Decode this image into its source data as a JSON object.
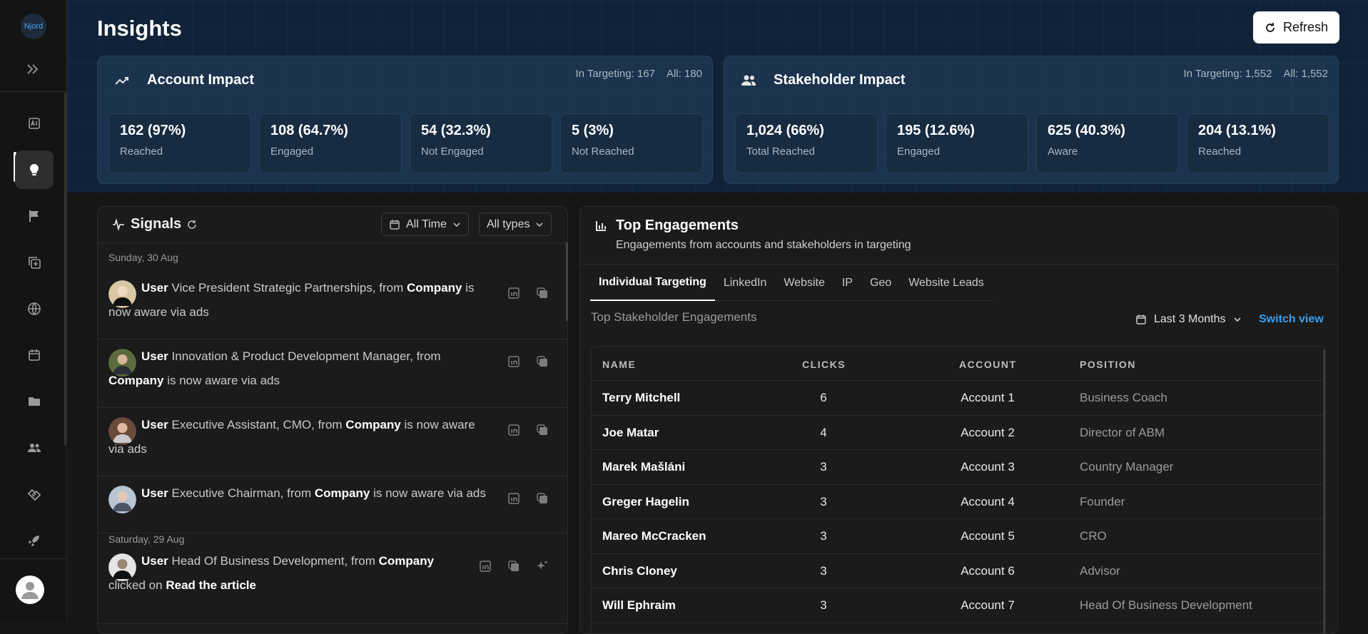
{
  "sidebar": {
    "logo_text": "Njord",
    "nav": [
      {
        "icon": "ai-report-icon",
        "active": false
      },
      {
        "icon": "lightbulb-icon",
        "active": true
      },
      {
        "icon": "flag-icon",
        "active": false
      },
      {
        "icon": "add-copy-icon",
        "active": false
      },
      {
        "icon": "globe-icon",
        "active": false
      },
      {
        "icon": "calendar-icon",
        "active": false
      },
      {
        "icon": "folder-icon",
        "active": false
      },
      {
        "icon": "people-icon",
        "active": false
      },
      {
        "icon": "handshake-icon",
        "active": false
      },
      {
        "icon": "rocket-icon",
        "active": false
      }
    ]
  },
  "header": {
    "title": "Insights",
    "refresh_label": "Refresh"
  },
  "account_impact": {
    "title": "Account Impact",
    "in_targeting": "In Targeting: 167",
    "all": "All: 180",
    "metrics": [
      {
        "value": "162 (97%)",
        "label": "Reached"
      },
      {
        "value": "108 (64.7%)",
        "label": "Engaged"
      },
      {
        "value": "54 (32.3%)",
        "label": "Not Engaged"
      },
      {
        "value": "5 (3%)",
        "label": "Not Reached"
      }
    ]
  },
  "stakeholder_impact": {
    "title": "Stakeholder Impact",
    "in_targeting": "In Targeting: 1,552",
    "all": "All: 1,552",
    "metrics": [
      {
        "value": "1,024 (66%)",
        "label": "Total Reached"
      },
      {
        "value": "195 (12.6%)",
        "label": "Engaged"
      },
      {
        "value": "625 (40.3%)",
        "label": "Aware"
      },
      {
        "value": "204 (13.1%)",
        "label": "Reached"
      }
    ]
  },
  "signals": {
    "title": "Signals",
    "time_filter": "All Time",
    "type_filter": "All types",
    "day1": "Sunday, 30 Aug",
    "day2": "Saturday, 29 Aug",
    "items": [
      {
        "user": "User",
        "role": "Vice President Strategic Partnerships, from",
        "company": "Company",
        "action": "is now aware via ads"
      },
      {
        "user": "User",
        "role": "Innovation & Product Development Manager, from",
        "company": "Company",
        "action": "is now aware via ads"
      },
      {
        "user": "User",
        "role": "Executive Assistant, CMO, from",
        "company": "Company",
        "action": "is now aware via ads"
      },
      {
        "user": "User",
        "role": "Executive Chairman, from",
        "company": "Company",
        "action": "is now aware via ads"
      },
      {
        "user": "User",
        "role": "Head Of Business Development, from",
        "company": "Company",
        "action": "clicked on",
        "target": "Read the article"
      }
    ]
  },
  "engagements": {
    "title": "Top Engagements",
    "subtitle": "Engagements from accounts and stakeholders in targeting",
    "tabs": [
      "Individual Targeting",
      "LinkedIn",
      "Website",
      "IP",
      "Geo",
      "Website Leads"
    ],
    "section_label": "Top Stakeholder Engagements",
    "range": "Last 3 Months",
    "switch_view": "Switch view",
    "columns": [
      "NAME",
      "CLICKS",
      "ACCOUNT",
      "POSITION"
    ],
    "rows": [
      {
        "name": "Terry Mitchell",
        "clicks": "6",
        "account": "Account 1",
        "position": "Business Coach"
      },
      {
        "name": "Joe Matar",
        "clicks": "4",
        "account": "Account 2",
        "position": "Director of ABM"
      },
      {
        "name": "Marek Mašláni",
        "clicks": "3",
        "account": "Account 3",
        "position": "Country Manager"
      },
      {
        "name": "Greger Hagelin",
        "clicks": "3",
        "account": "Account 4",
        "position": "Founder"
      },
      {
        "name": "Mareo McCracken",
        "clicks": "3",
        "account": "Account 5",
        "position": "CRO"
      },
      {
        "name": "Chris Cloney",
        "clicks": "3",
        "account": "Account 6",
        "position": "Advisor"
      },
      {
        "name": "Will Ephraim",
        "clicks": "3",
        "account": "Account 7",
        "position": "Head Of Business Development"
      }
    ]
  }
}
